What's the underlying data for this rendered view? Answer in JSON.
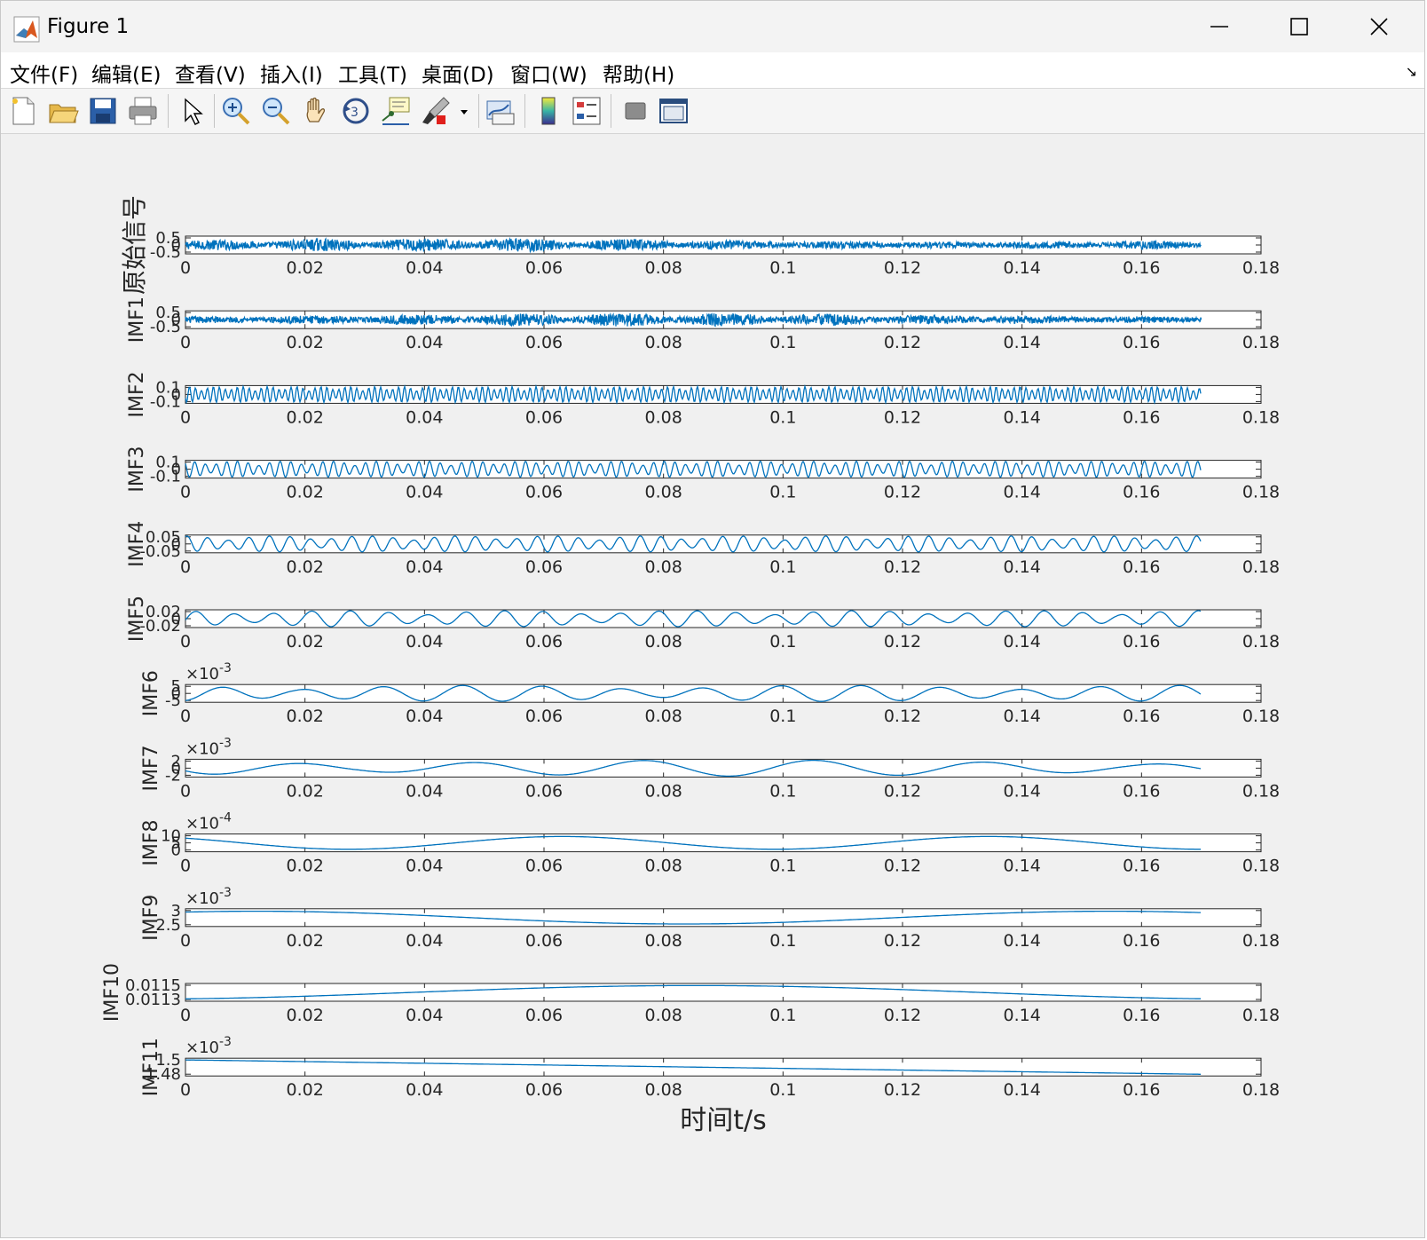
{
  "window": {
    "title": "Figure 1",
    "minimize_icon": "minimize-icon",
    "maximize_icon": "maximize-icon",
    "close_icon": "close-icon"
  },
  "menu": {
    "items": [
      "文件(F)",
      "编辑(E)",
      "查看(V)",
      "插入(I)",
      "工具(T)",
      "桌面(D)",
      "窗口(W)",
      "帮助(H)"
    ]
  },
  "toolbar": {
    "buttons": [
      "new-figure-icon",
      "open-file-icon",
      "save-icon",
      "print-icon",
      "edit-plot-arrow-icon",
      "zoom-in-icon",
      "zoom-out-icon",
      "pan-hand-icon",
      "rotate-3d-icon",
      "data-cursor-icon",
      "brush-icon",
      "link-plot-icon",
      "colorbar-icon",
      "legend-icon",
      "hide-plot-tools-icon",
      "show-plot-tools-icon"
    ]
  },
  "chart_data": {
    "type": "line",
    "xlabel": "时间t/s",
    "xlim": [
      0,
      0.18
    ],
    "xticks": [
      "0",
      "0.02",
      "0.04",
      "0.06",
      "0.08",
      "0.1",
      "0.12",
      "0.14",
      "0.16",
      "0.18"
    ],
    "signal_end": 0.17,
    "color": "#0072BD",
    "subplots": [
      {
        "ylabel": "原始信号",
        "yticks": [
          "0.5",
          "0",
          "-0.5"
        ],
        "exponent": "",
        "kind": "noise",
        "amplitude": 0.42,
        "freq": 1400
      },
      {
        "ylabel": "IMF1",
        "yticks": [
          "0.5",
          "0",
          "-0.5"
        ],
        "exponent": "",
        "kind": "noise",
        "amplitude": 0.4,
        "freq": 1400
      },
      {
        "ylabel": "IMF2",
        "yticks": [
          "0.1",
          "0",
          "-0.1"
        ],
        "exponent": "",
        "kind": "oscillation",
        "amplitude": 0.06,
        "freq": 1000
      },
      {
        "ylabel": "IMF3",
        "yticks": [
          "0.1",
          "0",
          "-0.1"
        ],
        "exponent": "",
        "kind": "oscillation",
        "amplitude": 0.06,
        "freq": 560
      },
      {
        "ylabel": "IMF4",
        "yticks": [
          "0.05",
          "0",
          "-0.05"
        ],
        "exponent": "",
        "kind": "oscillation",
        "amplitude": 0.03,
        "freq": 290
      },
      {
        "ylabel": "IMF5",
        "yticks": [
          "0.02",
          "0",
          "-0.02"
        ],
        "exponent": "",
        "kind": "oscillation",
        "amplitude": 0.017,
        "freq": 155
      },
      {
        "ylabel": "IMF6",
        "yticks": [
          "5",
          "0",
          "-5"
        ],
        "exponent": "-3",
        "kind": "oscillation",
        "amplitude": 5,
        "freq": 75
      },
      {
        "ylabel": "IMF7",
        "yticks": [
          "2",
          "0",
          "-2"
        ],
        "exponent": "-3",
        "kind": "oscillation",
        "amplitude": 1.8,
        "freq": 35
      },
      {
        "ylabel": "IMF8",
        "yticks": [
          "10",
          "5",
          "0"
        ],
        "exponent": "-4",
        "kind": "oscillation",
        "amplitude": 5,
        "freq": 14
      },
      {
        "ylabel": "IMF9",
        "yticks": [
          "3",
          "2.5"
        ],
        "exponent": "-3",
        "kind": "oscillation",
        "amplitude": 0.3,
        "freq": 7
      },
      {
        "ylabel": "IMF10",
        "yticks": [
          "0.0115",
          "0.0113"
        ],
        "exponent": "",
        "kind": "trend",
        "amplitude": 0.0001,
        "freq": 3
      },
      {
        "ylabel": "IMF11",
        "yticks": [
          "1.5",
          "1.48"
        ],
        "exponent": "-3",
        "kind": "decay",
        "amplitude": 0.02,
        "freq": 1
      }
    ]
  }
}
